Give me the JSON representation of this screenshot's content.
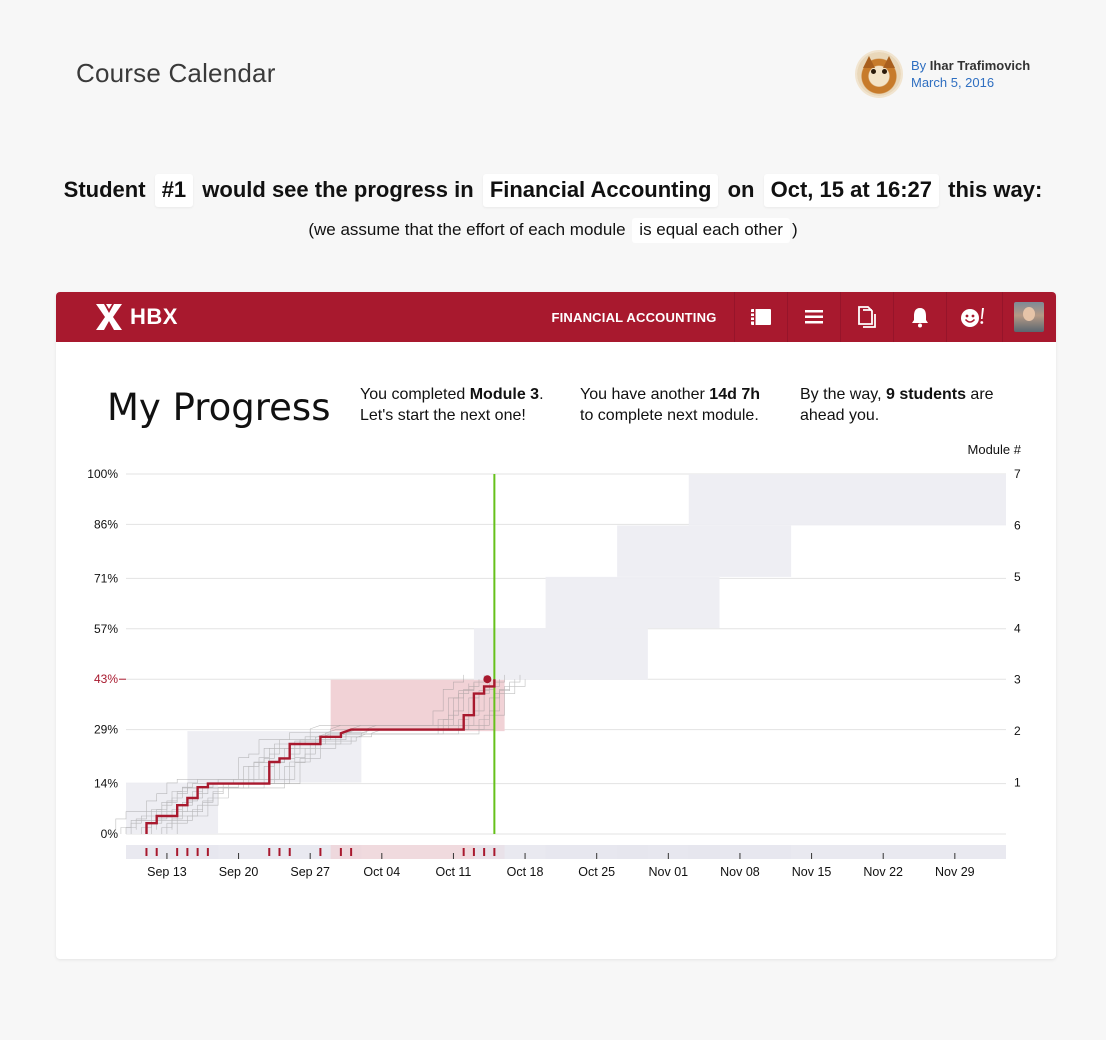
{
  "page": {
    "title": "Course Calendar",
    "author_by": "By",
    "author_name": "Ihar Trafimovich",
    "date": "March 5, 2016"
  },
  "sentence": {
    "student_word": "Student",
    "student_id": "#1",
    "progress_text": "would see the progress in",
    "course": "Financial Accounting",
    "on_word": "on",
    "datetime": "Oct, 15 at 16:27",
    "this_way": "this way:",
    "assume_prefix": "(we assume that the effort of each module",
    "assume_value": "is equal each other",
    "assume_suffix": ")"
  },
  "navbar": {
    "brand": "HBX",
    "course_label": "FINANCIAL ACCOUNTING",
    "icons": [
      "notebook-icon",
      "menu-icon",
      "documents-icon",
      "bell-icon",
      "smiley-icon",
      "user-avatar"
    ]
  },
  "progress": {
    "title": "My Progress",
    "info1_pre": "You completed ",
    "info1_bold": "Module 3",
    "info1_post": ".",
    "info1_line2": "Let's start the next one!",
    "info2_pre": "You have another ",
    "info2_bold": "14d 7h",
    "info2_line2": "to complete next module.",
    "info3_pre": "By the way, ",
    "info3_bold": "9 students",
    "info3_post": " are",
    "info3_line2": "ahead you."
  },
  "colors": {
    "brand": "#a8192e",
    "student_line": "#a8192e",
    "today_line": "#66c11b",
    "module_band": "#ededf2",
    "current_module_band": "#f0d0d4",
    "peer_lines": "#8c8c8c"
  },
  "chart_data": {
    "type": "line",
    "x_type": "date",
    "y_axis_left": {
      "ticks": [
        "0%",
        "14%",
        "29%",
        "43%",
        "57%",
        "71%",
        "86%",
        "100%"
      ],
      "values": [
        0,
        14,
        29,
        43,
        57,
        71,
        86,
        100
      ],
      "highlight": "43%",
      "range": [
        0,
        100
      ]
    },
    "y_axis_right": {
      "label": "Module #",
      "ticks": [
        "1",
        "2",
        "3",
        "4",
        "5",
        "6",
        "7"
      ],
      "values": [
        1,
        2,
        3,
        4,
        5,
        6,
        7
      ]
    },
    "x_axis": {
      "ticks": [
        "Sep 13",
        "Sep 20",
        "Sep 27",
        "Oct 04",
        "Oct 11",
        "Oct 18",
        "Oct 25",
        "Nov 01",
        "Nov 08",
        "Nov 15",
        "Nov 22",
        "Nov 29"
      ],
      "tick_dates": [
        "2015-09-13",
        "2015-09-20",
        "2015-09-27",
        "2015-10-04",
        "2015-10-11",
        "2015-10-18",
        "2015-10-25",
        "2015-11-01",
        "2015-11-08",
        "2015-11-15",
        "2015-11-22",
        "2015-11-29"
      ],
      "range": [
        "2015-09-09",
        "2015-12-04"
      ]
    },
    "today": "2015-10-15",
    "module_windows": [
      {
        "module": 1,
        "start": "2015-09-09",
        "end": "2015-09-18"
      },
      {
        "module": 2,
        "start": "2015-09-15",
        "end": "2015-10-02"
      },
      {
        "module": 3,
        "start": "2015-09-29",
        "end": "2015-10-16"
      },
      {
        "module": 4,
        "start": "2015-10-13",
        "end": "2015-10-30"
      },
      {
        "module": 5,
        "start": "2015-10-20",
        "end": "2015-11-06"
      },
      {
        "module": 6,
        "start": "2015-10-27",
        "end": "2015-11-13"
      },
      {
        "module": 7,
        "start": "2015-11-03",
        "end": "2015-12-04"
      }
    ],
    "series": [
      {
        "role": "student",
        "points": [
          [
            "2015-09-11",
            0
          ],
          [
            "2015-09-11",
            3
          ],
          [
            "2015-09-12",
            3
          ],
          [
            "2015-09-12",
            5
          ],
          [
            "2015-09-14",
            5
          ],
          [
            "2015-09-14",
            8
          ],
          [
            "2015-09-15",
            8
          ],
          [
            "2015-09-15",
            10
          ],
          [
            "2015-09-16",
            10
          ],
          [
            "2015-09-16",
            13
          ],
          [
            "2015-09-17",
            13
          ],
          [
            "2015-09-17",
            14
          ],
          [
            "2015-09-23",
            14
          ],
          [
            "2015-09-23",
            20
          ],
          [
            "2015-09-24",
            20
          ],
          [
            "2015-09-24",
            21
          ],
          [
            "2015-09-25",
            21
          ],
          [
            "2015-09-25",
            25
          ],
          [
            "2015-09-28",
            25
          ],
          [
            "2015-09-28",
            27
          ],
          [
            "2015-09-30",
            27
          ],
          [
            "2015-09-30",
            28
          ],
          [
            "2015-10-01",
            29
          ],
          [
            "2015-10-12",
            29
          ],
          [
            "2015-10-12",
            33
          ],
          [
            "2015-10-13",
            33
          ],
          [
            "2015-10-13",
            37
          ],
          [
            "2015-10-13",
            39
          ],
          [
            "2015-10-14",
            39
          ],
          [
            "2015-10-14",
            41
          ],
          [
            "2015-10-15",
            41
          ],
          [
            "2015-10-15",
            43
          ]
        ]
      }
    ]
  }
}
